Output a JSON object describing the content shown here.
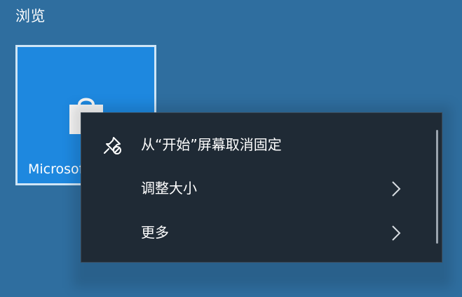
{
  "section": {
    "title": "浏览"
  },
  "tile": {
    "app_label": "Microsoft Store",
    "icon": "shopping-bag-icon"
  },
  "context_menu": {
    "items": [
      {
        "label": "从“开始”屏幕取消固定",
        "icon": "unpin-icon",
        "has_submenu": false
      },
      {
        "label": "调整大小",
        "icon": "",
        "has_submenu": true
      },
      {
        "label": "更多",
        "icon": "",
        "has_submenu": true
      }
    ]
  },
  "colors": {
    "desktop_background": "#2f6e9f",
    "tile_background": "#1e88df",
    "menu_background": "#1f2a35",
    "text": "#ffffff"
  }
}
